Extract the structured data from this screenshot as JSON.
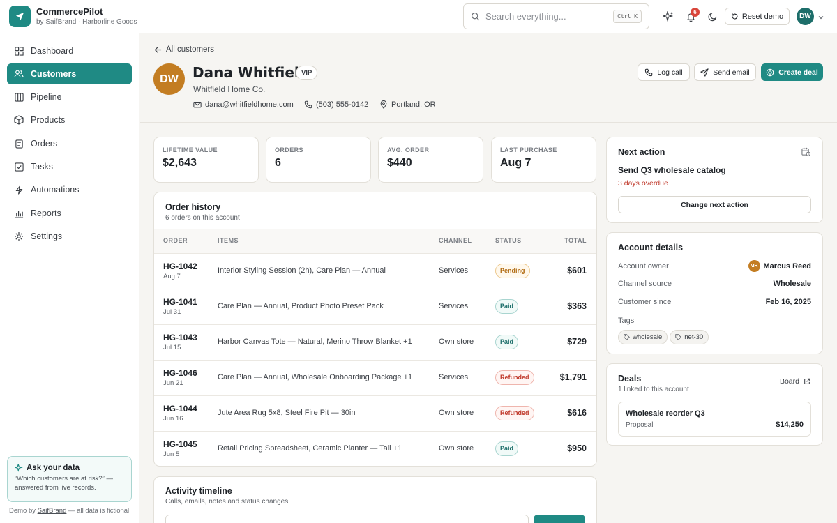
{
  "app": {
    "name": "CommercePilot",
    "sub": "by SaifBrand · Harborline Goods"
  },
  "topbar": {
    "search_placeholder": "Search everything...",
    "shortcut": "Ctrl K",
    "notifications": "6",
    "reset_label": "Reset demo",
    "user_initials": "DW"
  },
  "sidebar": {
    "items": [
      {
        "label": "Dashboard",
        "icon": "grid-icon"
      },
      {
        "label": "Customers",
        "icon": "users-icon"
      },
      {
        "label": "Pipeline",
        "icon": "columns-icon"
      },
      {
        "label": "Products",
        "icon": "box-icon"
      },
      {
        "label": "Orders",
        "icon": "document-icon"
      },
      {
        "label": "Tasks",
        "icon": "checkbox-icon"
      },
      {
        "label": "Automations",
        "icon": "bolt-icon"
      },
      {
        "label": "Reports",
        "icon": "bar-chart-icon"
      },
      {
        "label": "Settings",
        "icon": "gear-icon"
      }
    ],
    "active": "Customers",
    "ask": {
      "title": "Ask your data",
      "text": "“Which customers are at risk?” — answered from live records."
    },
    "footer_prefix": "Demo by ",
    "footer_brand": "SaifBrand",
    "footer_suffix": " — all data is fictional."
  },
  "customer": {
    "back_label": "All customers",
    "initials": "DW",
    "name": "Dana Whitfield",
    "badge": "VIP",
    "company": "Whitfield Home Co.",
    "email": "dana@whitfieldhome.com",
    "phone": "(503) 555-0142",
    "location": "Portland, OR",
    "actions": {
      "log_call": "Log call",
      "send_email": "Send email",
      "create_deal": "Create deal"
    }
  },
  "stats": [
    {
      "label": "LIFETIME VALUE",
      "value": "$2,643"
    },
    {
      "label": "ORDERS",
      "value": "6"
    },
    {
      "label": "AVG. ORDER",
      "value": "$440"
    },
    {
      "label": "LAST PURCHASE",
      "value": "Aug 7"
    }
  ],
  "orders": {
    "title": "Order history",
    "subtitle": "6 orders on this account",
    "columns": {
      "order": "ORDER",
      "items": "ITEMS",
      "channel": "CHANNEL",
      "status": "STATUS",
      "total": "TOTAL"
    },
    "rows": [
      {
        "id": "HG-1042",
        "date": "Aug 7",
        "items": "Interior Styling Session (2h), Care Plan — Annual",
        "channel": "Services",
        "status": "Pending",
        "total": "$601"
      },
      {
        "id": "HG-1041",
        "date": "Jul 31",
        "items": "Care Plan — Annual, Product Photo Preset Pack",
        "channel": "Services",
        "status": "Paid",
        "total": "$363"
      },
      {
        "id": "HG-1043",
        "date": "Jul 15",
        "items": "Harbor Canvas Tote — Natural, Merino Throw Blanket +1",
        "channel": "Own store",
        "status": "Paid",
        "total": "$729"
      },
      {
        "id": "HG-1046",
        "date": "Jun 21",
        "items": "Care Plan — Annual, Wholesale Onboarding Package +1",
        "channel": "Services",
        "status": "Refunded",
        "total": "$1,791"
      },
      {
        "id": "HG-1044",
        "date": "Jun 16",
        "items": "Jute Area Rug 5x8, Steel Fire Pit — 30in",
        "channel": "Own store",
        "status": "Refunded",
        "total": "$616"
      },
      {
        "id": "HG-1045",
        "date": "Jun 5",
        "items": "Retail Pricing Spreadsheet, Ceramic Planter — Tall +1",
        "channel": "Own store",
        "status": "Paid",
        "total": "$950"
      }
    ]
  },
  "timeline": {
    "title": "Activity timeline",
    "subtitle": "Calls, emails, notes and status changes"
  },
  "next_action": {
    "title": "Next action",
    "task": "Send Q3 wholesale catalog",
    "overdue": "3 days overdue",
    "button": "Change next action"
  },
  "account": {
    "title": "Account details",
    "owner_label": "Account owner",
    "owner_initials": "MR",
    "owner": "Marcus Reed",
    "channel_label": "Channel source",
    "channel": "Wholesale",
    "since_label": "Customer since",
    "since": "Feb 16, 2025",
    "tags_label": "Tags",
    "tags": [
      "wholesale",
      "net-30"
    ]
  },
  "deals": {
    "title": "Deals",
    "subtitle": "1 linked to this account",
    "board_label": "Board",
    "deal_name": "Wholesale reorder Q3",
    "deal_stage": "Proposal",
    "deal_value": "$14,250"
  },
  "colors": {
    "accent": "#1f8a84",
    "avatar": "#c37d22",
    "overdue": "#c0392b",
    "pending": "#b06a10"
  }
}
